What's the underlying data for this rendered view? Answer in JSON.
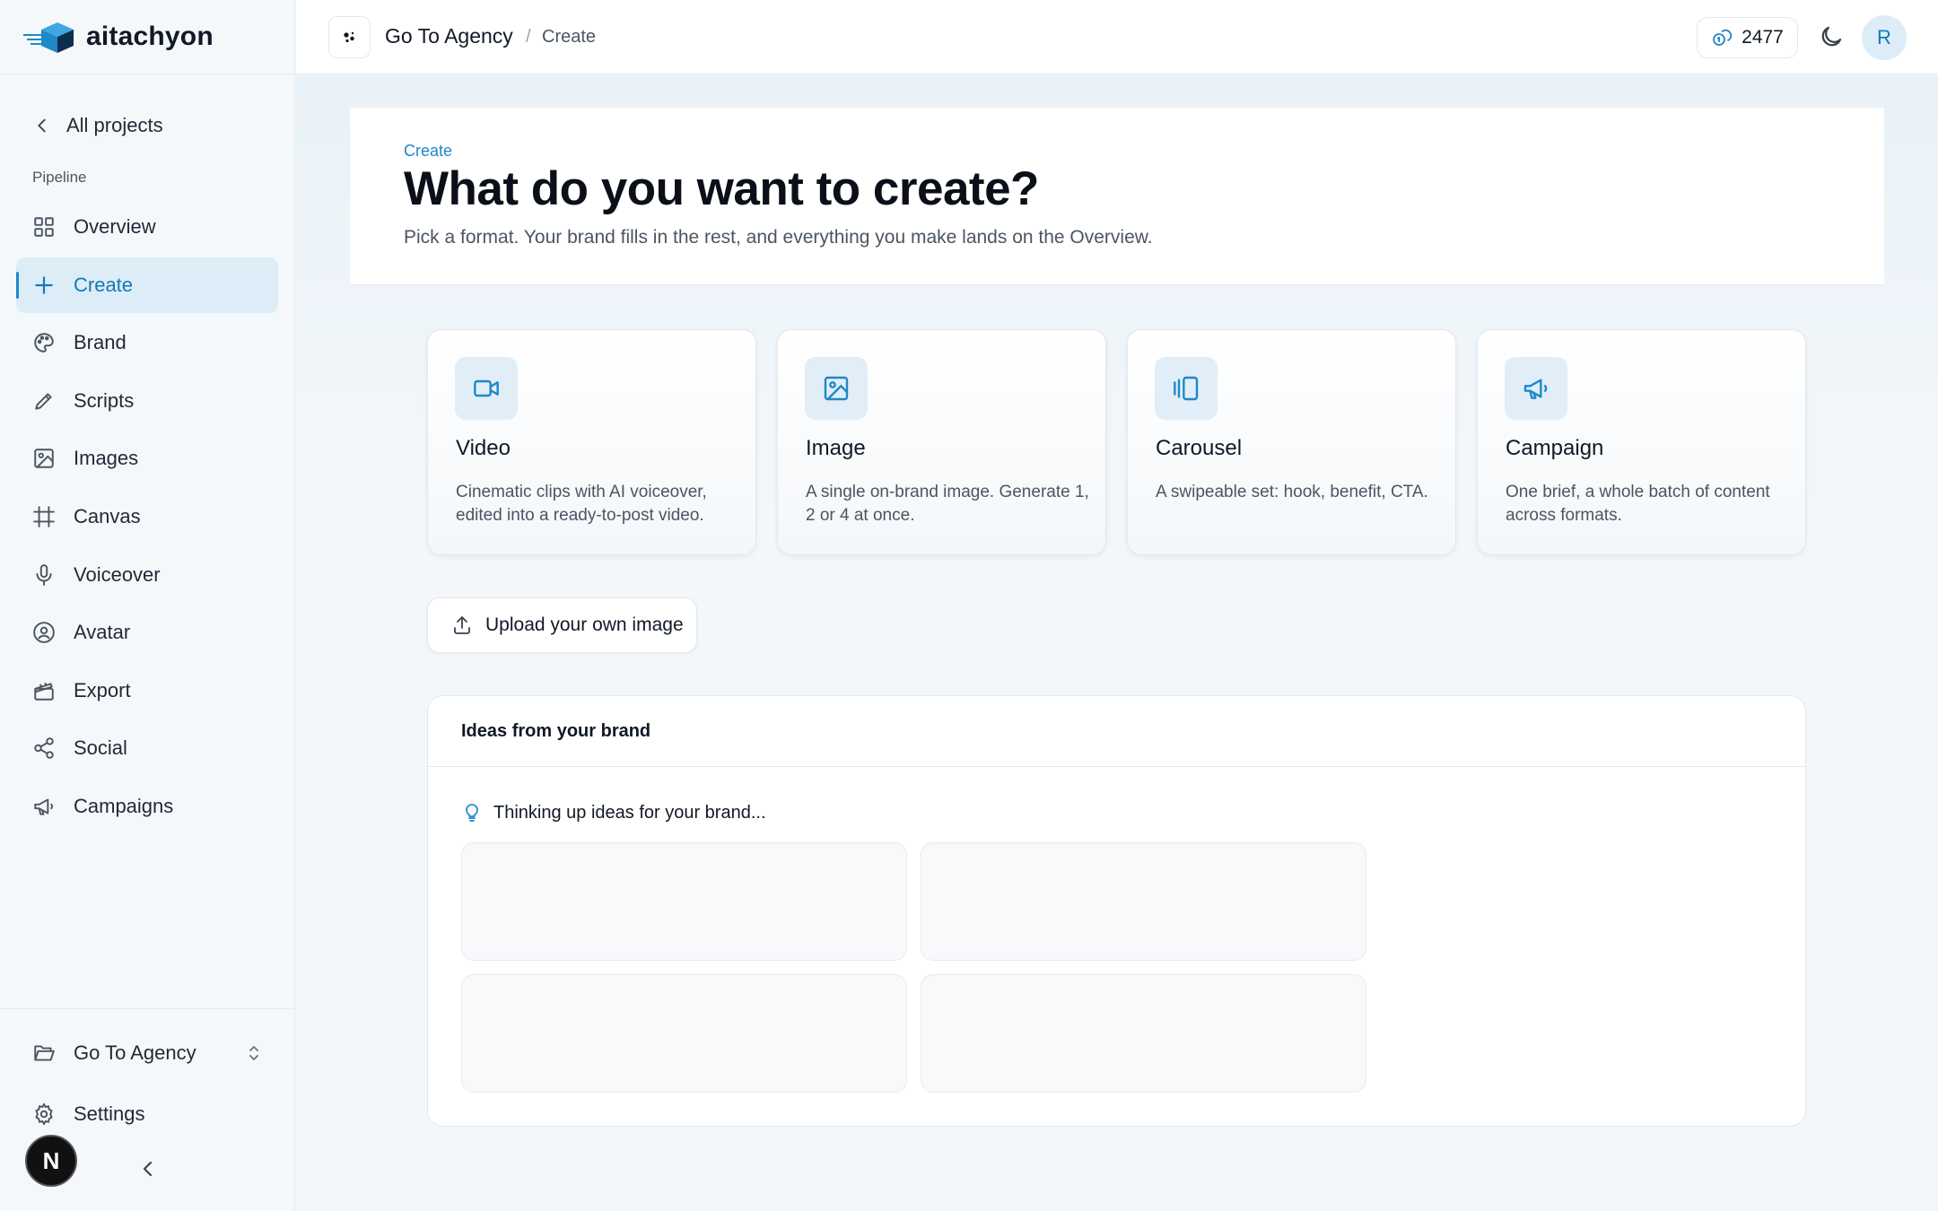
{
  "app": {
    "name": "aitachyon"
  },
  "sidebar": {
    "back_label": "All projects",
    "section_label": "Pipeline",
    "items": [
      {
        "label": "Overview",
        "icon": "grid-icon"
      },
      {
        "label": "Create",
        "icon": "plus-icon",
        "active": true
      },
      {
        "label": "Brand",
        "icon": "palette-icon"
      },
      {
        "label": "Scripts",
        "icon": "pencil-icon"
      },
      {
        "label": "Images",
        "icon": "image-icon"
      },
      {
        "label": "Canvas",
        "icon": "frame-icon"
      },
      {
        "label": "Voiceover",
        "icon": "microphone-icon"
      },
      {
        "label": "Avatar",
        "icon": "user-circle-icon"
      },
      {
        "label": "Export",
        "icon": "clapperboard-icon"
      },
      {
        "label": "Social",
        "icon": "share-icon"
      },
      {
        "label": "Campaigns",
        "icon": "megaphone-icon"
      }
    ],
    "project_selector": "Go To Agency",
    "settings_label": "Settings",
    "dev_badge": "N"
  },
  "topbar": {
    "breadcrumb_project": "Go To Agency",
    "breadcrumb_separator": "/",
    "breadcrumb_current": "Create",
    "credits": "2477",
    "user_initial": "R"
  },
  "hero": {
    "eyebrow": "Create",
    "title": "What do you want to create?",
    "subtitle": "Pick a format. Your brand fills in the rest, and everything you make lands on the Overview."
  },
  "formats": [
    {
      "title": "Video",
      "desc": "Cinematic clips with AI voiceover, edited into a ready-to-post video.",
      "icon": "video-camera-icon"
    },
    {
      "title": "Image",
      "desc": "A single on-brand image. Generate 1, 2 or 4 at once.",
      "icon": "image-icon"
    },
    {
      "title": "Carousel",
      "desc": "A swipeable set: hook, benefit, CTA.",
      "icon": "carousel-icon"
    },
    {
      "title": "Campaign",
      "desc": "One brief, a whole batch of content across formats.",
      "icon": "megaphone-icon"
    }
  ],
  "upload_button": "Upload your own image",
  "ideas": {
    "heading": "Ideas from your brand",
    "loading_text": "Thinking up ideas for your brand..."
  },
  "colors": {
    "accent": "#1e88c9",
    "active_bg": "#dcedf7",
    "text": "#111827"
  }
}
